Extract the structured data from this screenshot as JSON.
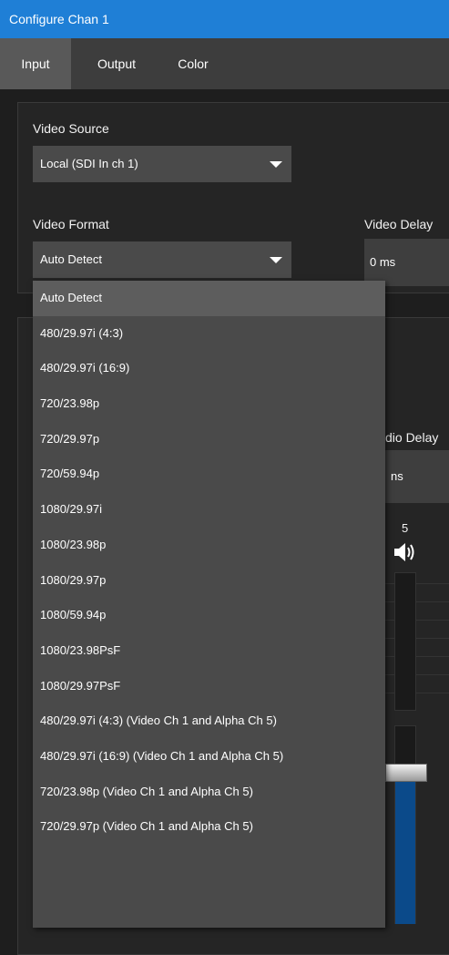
{
  "window": {
    "title": "Configure Chan 1"
  },
  "tabs": [
    {
      "label": "Input",
      "active": true
    },
    {
      "label": "Output",
      "active": false
    },
    {
      "label": "Color",
      "active": false
    }
  ],
  "video": {
    "source_label": "Video Source",
    "source_value": "Local (SDI In ch 1)",
    "format_label": "Video Format",
    "format_value": "Auto Detect",
    "delay_label": "Video Delay",
    "delay_value": "0 ms"
  },
  "audio": {
    "delay_label_partial": "dio Delay",
    "delay_value_partial": "ns",
    "channel_number": "5"
  },
  "dropdown": {
    "options": [
      "Auto Detect",
      "480/29.97i (4:3)",
      "480/29.97i (16:9)",
      "720/23.98p",
      "720/29.97p",
      "720/59.94p",
      "1080/29.97i",
      "1080/23.98p",
      "1080/29.97p",
      "1080/59.94p",
      "1080/23.98PsF",
      "1080/29.97PsF",
      "480/29.97i (4:3) (Video Ch 1 and Alpha Ch 5)",
      "480/29.97i (16:9) (Video Ch 1 and Alpha Ch 5)",
      "720/23.98p (Video Ch 1 and Alpha Ch 5)",
      "720/29.97p (Video Ch 1 and Alpha Ch 5)"
    ],
    "selected_index": 0
  },
  "colors": {
    "accent": "#1f7fd6",
    "fader_fill": "#0b4a8a"
  }
}
